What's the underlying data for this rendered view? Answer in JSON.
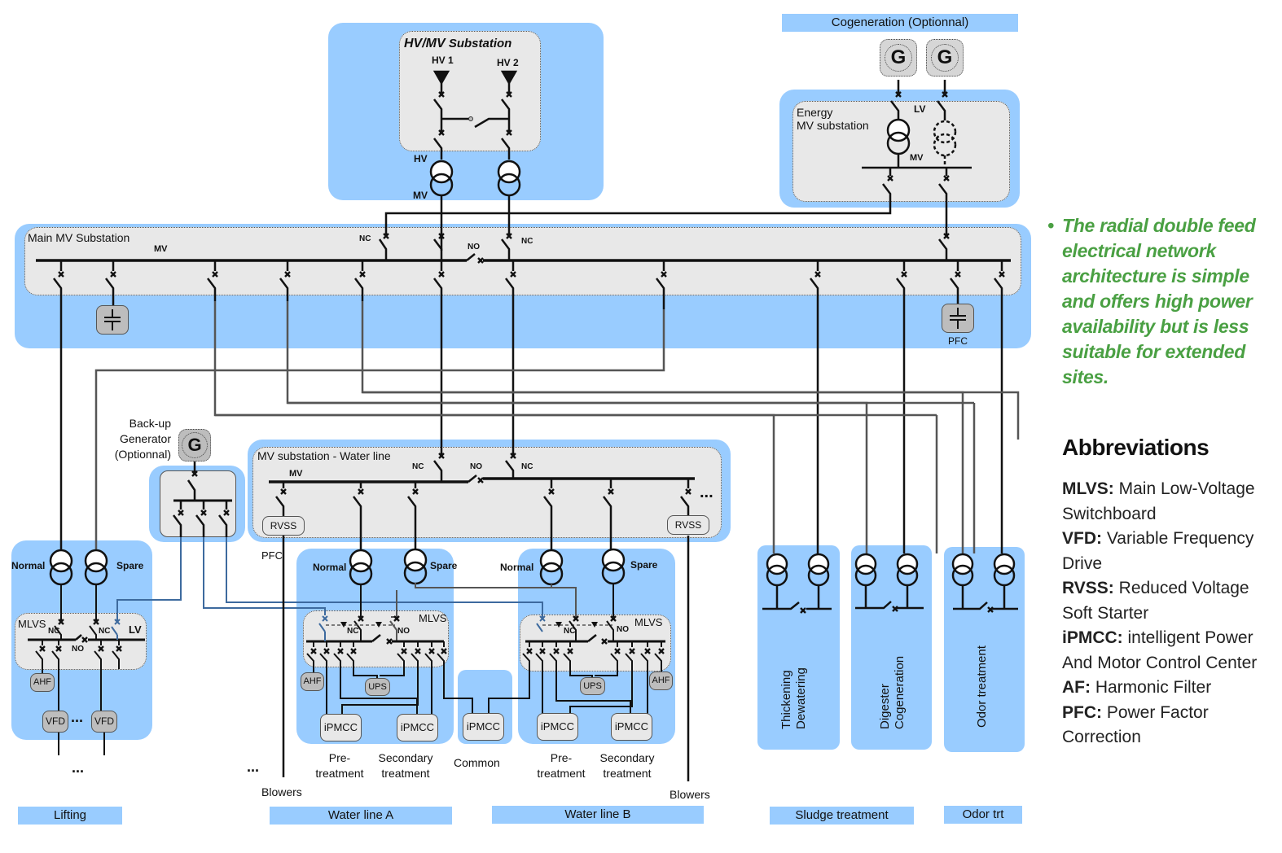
{
  "hv_mv_substation": {
    "title_italic": "HV/MV",
    "title_rest": "Substation",
    "inputs": [
      "HV 1",
      "HV 2"
    ],
    "hv_label": "HV",
    "mv_label": "MV"
  },
  "cogeneration": {
    "banner": "Cogeneration (Optionnal)",
    "generators": [
      "G",
      "G"
    ],
    "substation_title": "Energy\nMV substation",
    "lv_label": "LV",
    "mv_label": "MV"
  },
  "main_mv_substation": {
    "title": "Main MV Substation",
    "bus_label": "MV",
    "switch_labels": [
      "NC",
      "NO",
      "NC"
    ],
    "pfc_label": "PFC"
  },
  "backup_generator": {
    "label": "Back-up\nGenerator\n(Optionnal)",
    "generator": "G"
  },
  "water_line_substation": {
    "title": "MV substation - Water line",
    "bus_label": "MV",
    "switch_labels": [
      "NC",
      "NO",
      "NC"
    ],
    "devices": [
      "RVSS",
      "RVSS"
    ],
    "ellipsis": "...",
    "pfc_label": "PFC"
  },
  "lifting": {
    "transformers": [
      "Normal",
      "Spare"
    ],
    "mlvs_label": "MLVS",
    "lv_label": "LV",
    "switch_labels": [
      "NC",
      "NC",
      "NO"
    ],
    "devices": [
      "AHF",
      "VFD",
      "VFD"
    ],
    "ellipsis": "...",
    "bottom_ellipsis": "...",
    "banner": "Lifting"
  },
  "water_line_a": {
    "transformers": [
      "Normal",
      "Spare"
    ],
    "mlvs_label": "MLVS",
    "switch_labels": [
      "NC",
      "NO"
    ],
    "devices": [
      "AHF",
      "UPS",
      "iPMCC",
      "iPMCC"
    ],
    "captions": [
      "Pre-\ntreatment",
      "Secondary\ntreatment"
    ],
    "blowers": "Blowers",
    "ellipsis": "...",
    "banner": "Water line A"
  },
  "common": {
    "device": "iPMCC",
    "caption": "Common"
  },
  "water_line_b": {
    "transformers": [
      "Normal",
      "Spare"
    ],
    "mlvs_label": "MLVS",
    "switch_labels": [
      "NC",
      "NO"
    ],
    "devices": [
      "UPS",
      "AHF",
      "iPMCC",
      "iPMCC"
    ],
    "captions": [
      "Pre-\ntreatment",
      "Secondary\ntreatment"
    ],
    "blowers": "Blowers",
    "banner": "Water line B"
  },
  "sludge": {
    "units": [
      "Thickening\nDewatering",
      "Digester\nCogeneration"
    ],
    "banner": "Sludge treatment"
  },
  "odor": {
    "unit": "Odor treatment",
    "banner": "Odor trt"
  },
  "note": {
    "bullet": "•",
    "text": "The radial double feed electrical network architecture is simple and offers high power availability but is less suitable for extended sites.",
    "color": "#4aa043"
  },
  "abbreviations": {
    "title": "Abbreviations",
    "items": [
      {
        "key": "MLVS:",
        "value": " Main Low-Voltage Switchboard"
      },
      {
        "key": "VFD:",
        "value": " Variable Frequency Drive"
      },
      {
        "key": "RVSS:",
        "value": " Reduced Voltage Soft Starter"
      },
      {
        "key": "iPMCC:",
        "value": " intelligent Power And Motor Control Center"
      },
      {
        "key": "AF:",
        "value": " Harmonic Filter"
      },
      {
        "key": "PFC:",
        "value": " Power Factor Correction"
      }
    ]
  },
  "colors": {
    "zone_blue": "#99ccff",
    "panel_grey": "#e8e8e8",
    "device_grey": "#bdbdbd",
    "backup_wire": "#3d6a9e",
    "feeder_grey": "#555555"
  }
}
